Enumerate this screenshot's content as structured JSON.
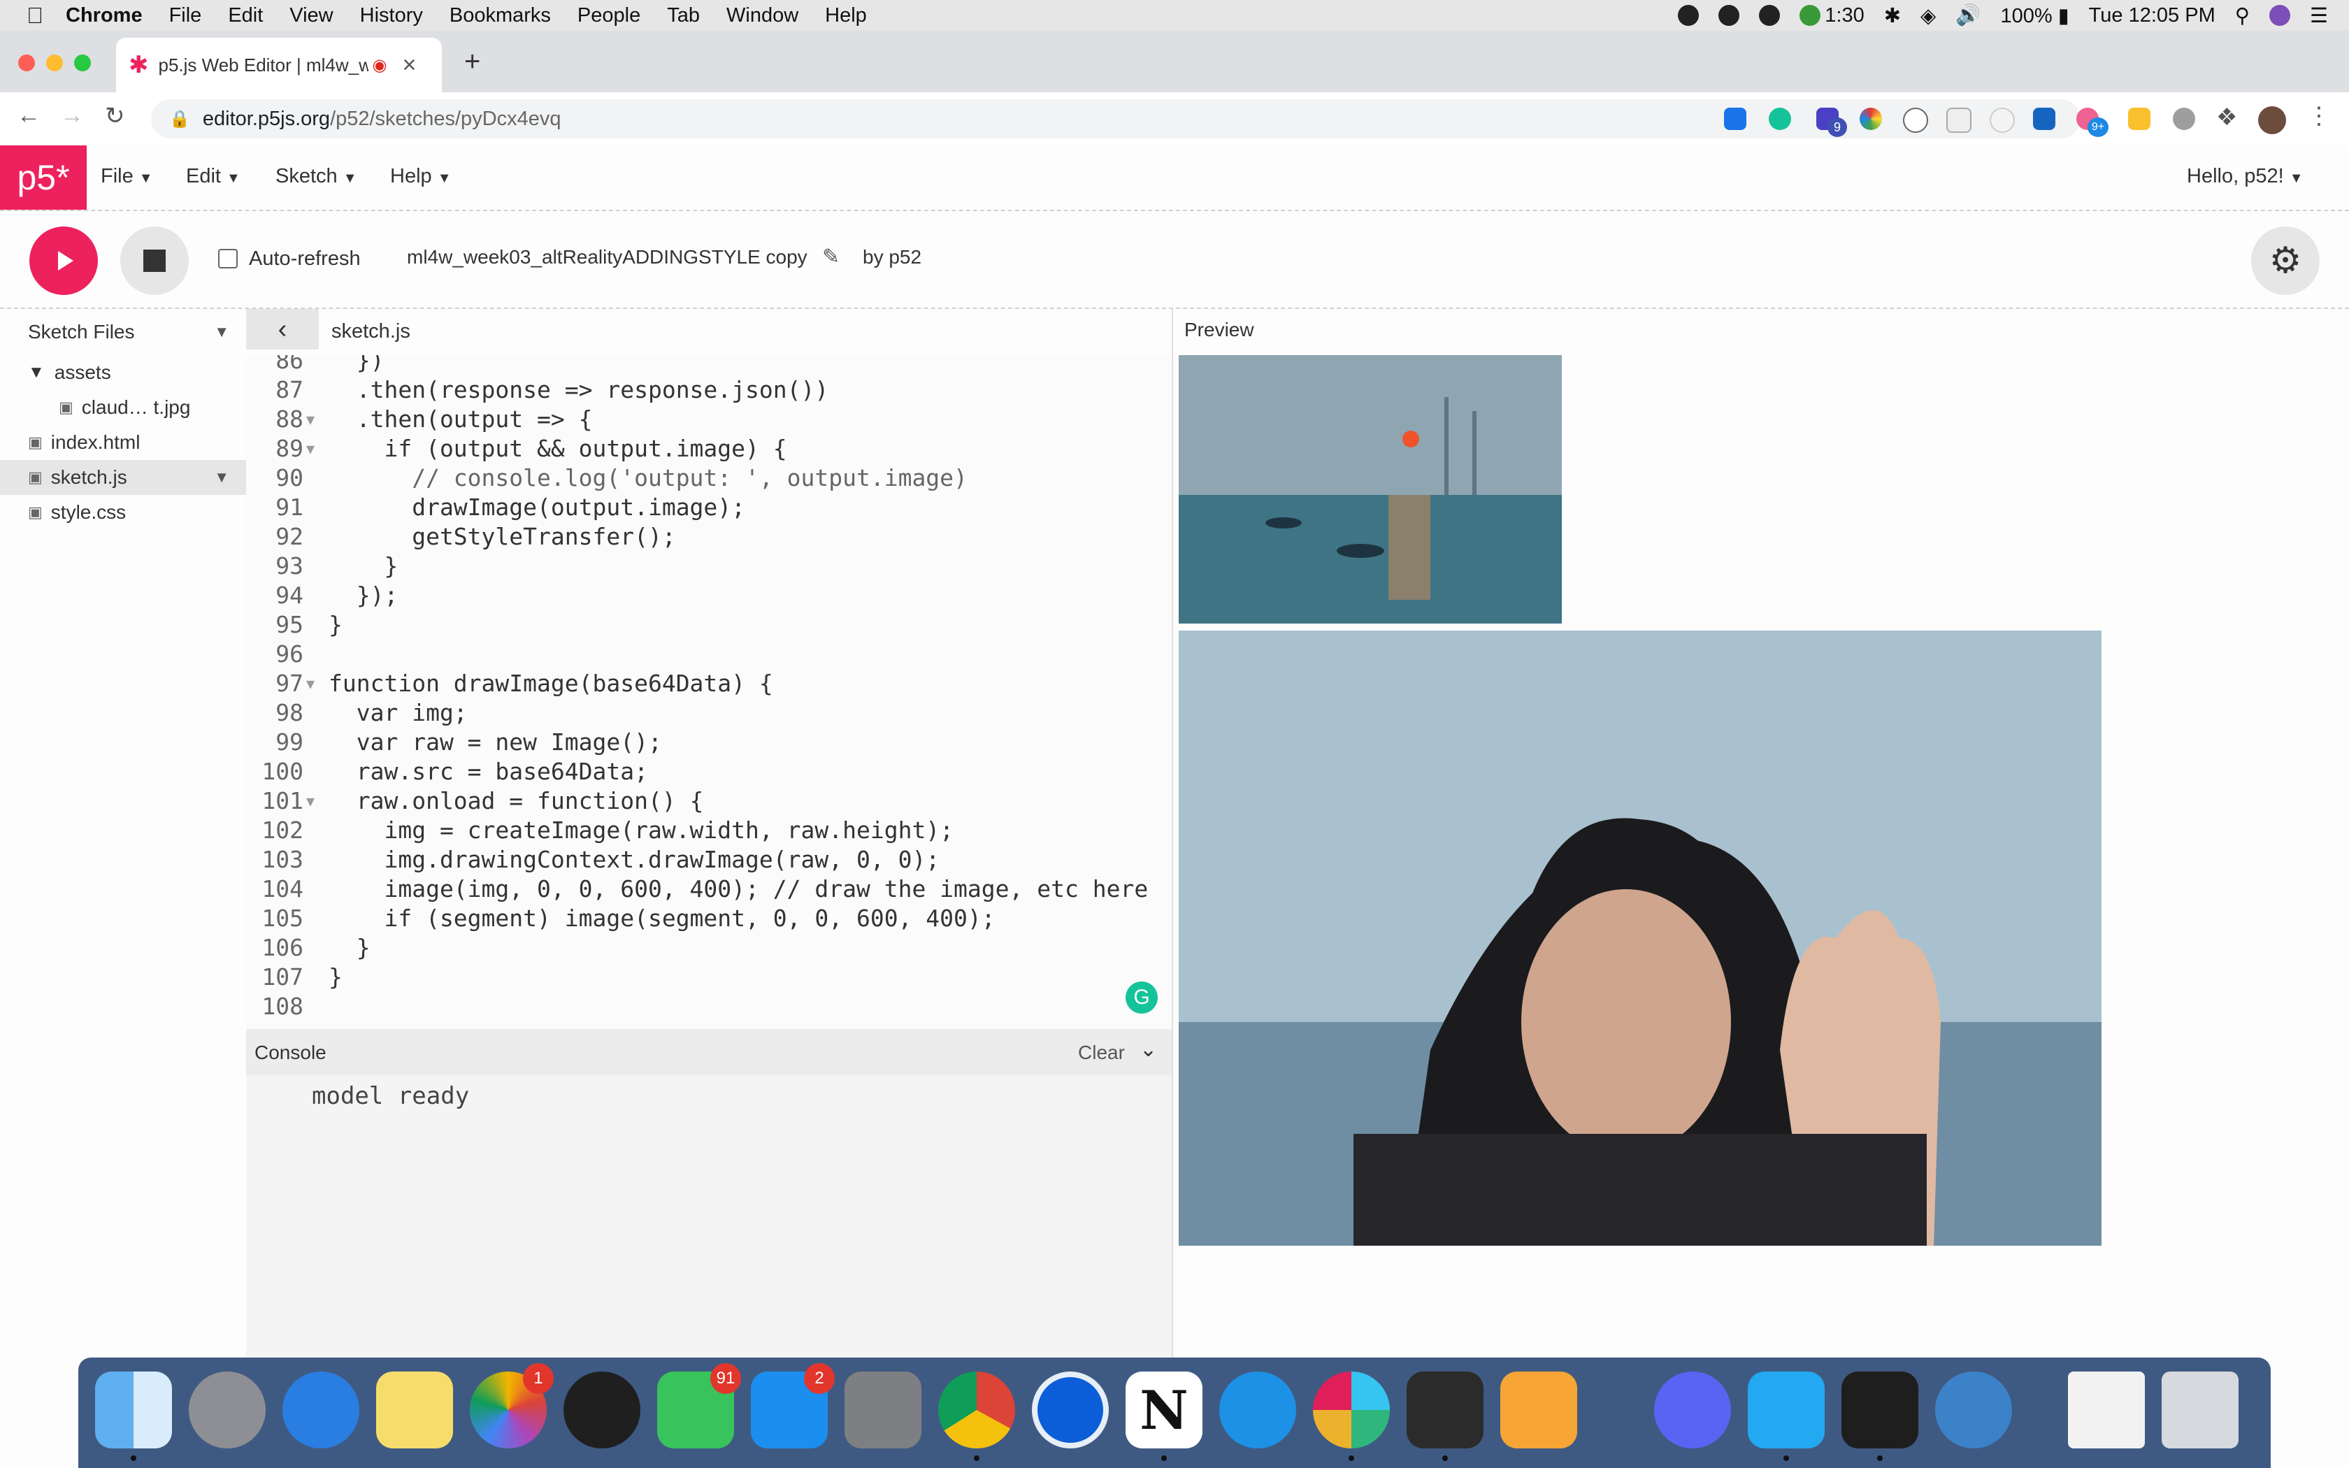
{
  "menubar": {
    "app": "Chrome",
    "items": [
      "File",
      "Edit",
      "View",
      "History",
      "Bookmarks",
      "People",
      "Tab",
      "Window",
      "Help"
    ],
    "timer": "1:30",
    "battery": "100%",
    "clock": "Tue 12:05 PM"
  },
  "browser": {
    "tab_title": "p5.js Web Editor | ml4w_w",
    "new_tab": "+",
    "close_tab": "×",
    "url_host": "editor.p5js.org",
    "url_path": "/p52/sketches/pyDcx4evq",
    "ext_badges": {
      "b1": "9",
      "b2": "9+"
    }
  },
  "p5nav": {
    "logo": "p5*",
    "menus": [
      "File",
      "Edit",
      "Sketch",
      "Help"
    ],
    "user": "Hello, p52!"
  },
  "toolbar": {
    "auto_refresh": "Auto-refresh",
    "sketch_name": "ml4w_week03_altRealityADDINGSTYLE copy",
    "by": "by p52"
  },
  "sidebar": {
    "title": "Sketch Files",
    "folder": "assets",
    "files": [
      "claud… t.jpg",
      "index.html",
      "sketch.js",
      "style.css"
    ],
    "selected": "sketch.js"
  },
  "editor": {
    "file_name": "sketch.js",
    "lines": [
      {
        "n": "86",
        "t": "  })"
      },
      {
        "n": "87",
        "t": "  .then(response => response.json())"
      },
      {
        "n": "88",
        "t": "  .then(output => {"
      },
      {
        "n": "89",
        "t": "    if (output && output.image) {"
      },
      {
        "n": "90",
        "t": "      // console.log('output: ', output.image)"
      },
      {
        "n": "91",
        "t": "      drawImage(output.image);"
      },
      {
        "n": "92",
        "t": "      getStyleTransfer();"
      },
      {
        "n": "93",
        "t": "    }"
      },
      {
        "n": "94",
        "t": "  });"
      },
      {
        "n": "95",
        "t": "}"
      },
      {
        "n": "96",
        "t": ""
      },
      {
        "n": "97",
        "t": "function drawImage(base64Data) {"
      },
      {
        "n": "98",
        "t": "  var img;"
      },
      {
        "n": "99",
        "t": "  var raw = new Image();"
      },
      {
        "n": "100",
        "t": "  raw.src = base64Data;"
      },
      {
        "n": "101",
        "t": "  raw.onload = function() {"
      },
      {
        "n": "102",
        "t": "    img = createImage(raw.width, raw.height);"
      },
      {
        "n": "103",
        "t": "    img.drawingContext.drawImage(raw, 0, 0);"
      },
      {
        "n": "104",
        "t": "    image(img, 0, 0, 600, 400); // draw the image, etc here"
      },
      {
        "n": "105",
        "t": "    if (segment) image(segment, 0, 0, 600, 400);"
      },
      {
        "n": "106",
        "t": "  }"
      },
      {
        "n": "107",
        "t": "}"
      },
      {
        "n": "108",
        "t": ""
      }
    ]
  },
  "console": {
    "title": "Console",
    "clear": "Clear",
    "output": "model ready"
  },
  "preview": {
    "title": "Preview"
  },
  "dock": {
    "badges": {
      "photos": "1",
      "facetime": "91",
      "appstore": "2"
    },
    "notion": "N"
  },
  "colors": {
    "p5_pink": "#ed225d",
    "keyword": "#704f21",
    "function": "#0b7ca9",
    "comment": "#666666"
  }
}
